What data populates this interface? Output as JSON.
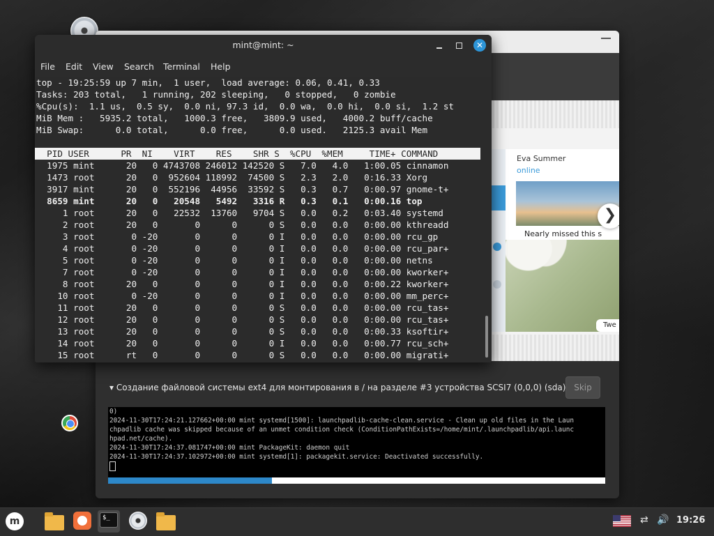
{
  "terminal": {
    "title": "mint@mint: ~",
    "menu": [
      "File",
      "Edit",
      "View",
      "Search",
      "Terminal",
      "Help"
    ],
    "summary": [
      "top - 19:25:59 up 7 min,  1 user,  load average: 0.06, 0.41, 0.33",
      "Tasks: 203 total,   1 running, 202 sleeping,   0 stopped,   0 zombie",
      "%Cpu(s):  1.1 us,  0.5 sy,  0.0 ni, 97.3 id,  0.0 wa,  0.0 hi,  0.0 si,  1.2 st",
      "MiB Mem :   5935.2 total,   1000.3 free,   3809.9 used,   4000.2 buff/cache",
      "MiB Swap:      0.0 total,      0.0 free,      0.0 used.   2125.3 avail Mem"
    ],
    "header": "  PID USER      PR  NI    VIRT    RES    SHR S  %CPU  %MEM     TIME+ COMMAND",
    "processes": [
      "  1975 mint      20   0 4743708 246012 142520 S   7.0   4.0   1:00.05 cinnamon",
      "  1473 root      20   0  952604 118992  74500 S   2.3   2.0   0:16.33 Xorg",
      "  3917 mint      20   0  552196  44956  33592 S   0.3   0.7   0:00.97 gnome-t+",
      "  8659 mint      20   0   20548   5492   3316 R   0.3   0.1   0:00.16 top",
      "     1 root      20   0   22532  13760   9704 S   0.0   0.2   0:03.40 systemd",
      "     2 root      20   0       0      0      0 S   0.0   0.0   0:00.00 kthreadd",
      "     3 root       0 -20       0      0      0 I   0.0   0.0   0:00.00 rcu_gp",
      "     4 root       0 -20       0      0      0 I   0.0   0.0   0:00.00 rcu_par+",
      "     5 root       0 -20       0      0      0 I   0.0   0.0   0:00.00 netns",
      "     7 root       0 -20       0      0      0 I   0.0   0.0   0:00.00 kworker+",
      "     8 root      20   0       0      0      0 I   0.0   0.0   0:00.22 kworker+",
      "    10 root       0 -20       0      0      0 I   0.0   0.0   0:00.00 mm_perc+",
      "    11 root      20   0       0      0      0 S   0.0   0.0   0:00.00 rcu_tas+",
      "    12 root      20   0       0      0      0 S   0.0   0.0   0:00.00 rcu_tas+",
      "    13 root      20   0       0      0      0 S   0.0   0.0   0:00.33 ksoftir+",
      "    14 root      20   0       0      0      0 I   0.0   0.0   0:00.77 rcu_sch+",
      "    15 root      rt   0       0      0      0 S   0.0   0.0   0:00.00 migrati+"
    ]
  },
  "installer": {
    "slide": {
      "contact_name": "Eva Summer",
      "contact_status": "online",
      "caption": "Nearly missed this s",
      "bubble_text": "Twe",
      "next_glyph": "❯"
    },
    "progress_text": "▾ Создание файловой системы ext4 для монтирования в / на разделе #3 устройства SCSI7 (0,0,0) (sda)...",
    "skip_label": "Skip",
    "log_lines": [
      "0)",
      "2024-11-30T17:24:21.127662+00:00 mint systemd[1500]: launchpadlib-cache-clean.service - Clean up old files in the Laun",
      "chpadlib cache was skipped because of an unmet condition check (ConditionPathExists=/home/mint/.launchpadlib/api.launc",
      "hpad.net/cache).",
      "2024-11-30T17:24:37.081747+00:00 mint PackageKit: daemon quit",
      "2024-11-30T17:24:37.102972+00:00 mint systemd[1]: packagekit.service: Deactivated successfully."
    ],
    "progress_fraction": 0.33
  },
  "taskbar": {
    "menu_glyph": "m",
    "terminal_glyph": "$_",
    "clock": "19:26",
    "volume_glyph": "🔊",
    "network_glyph": "⇄"
  },
  "colors": {
    "accent": "#2d88c9",
    "close_button": "#2d95d8"
  }
}
